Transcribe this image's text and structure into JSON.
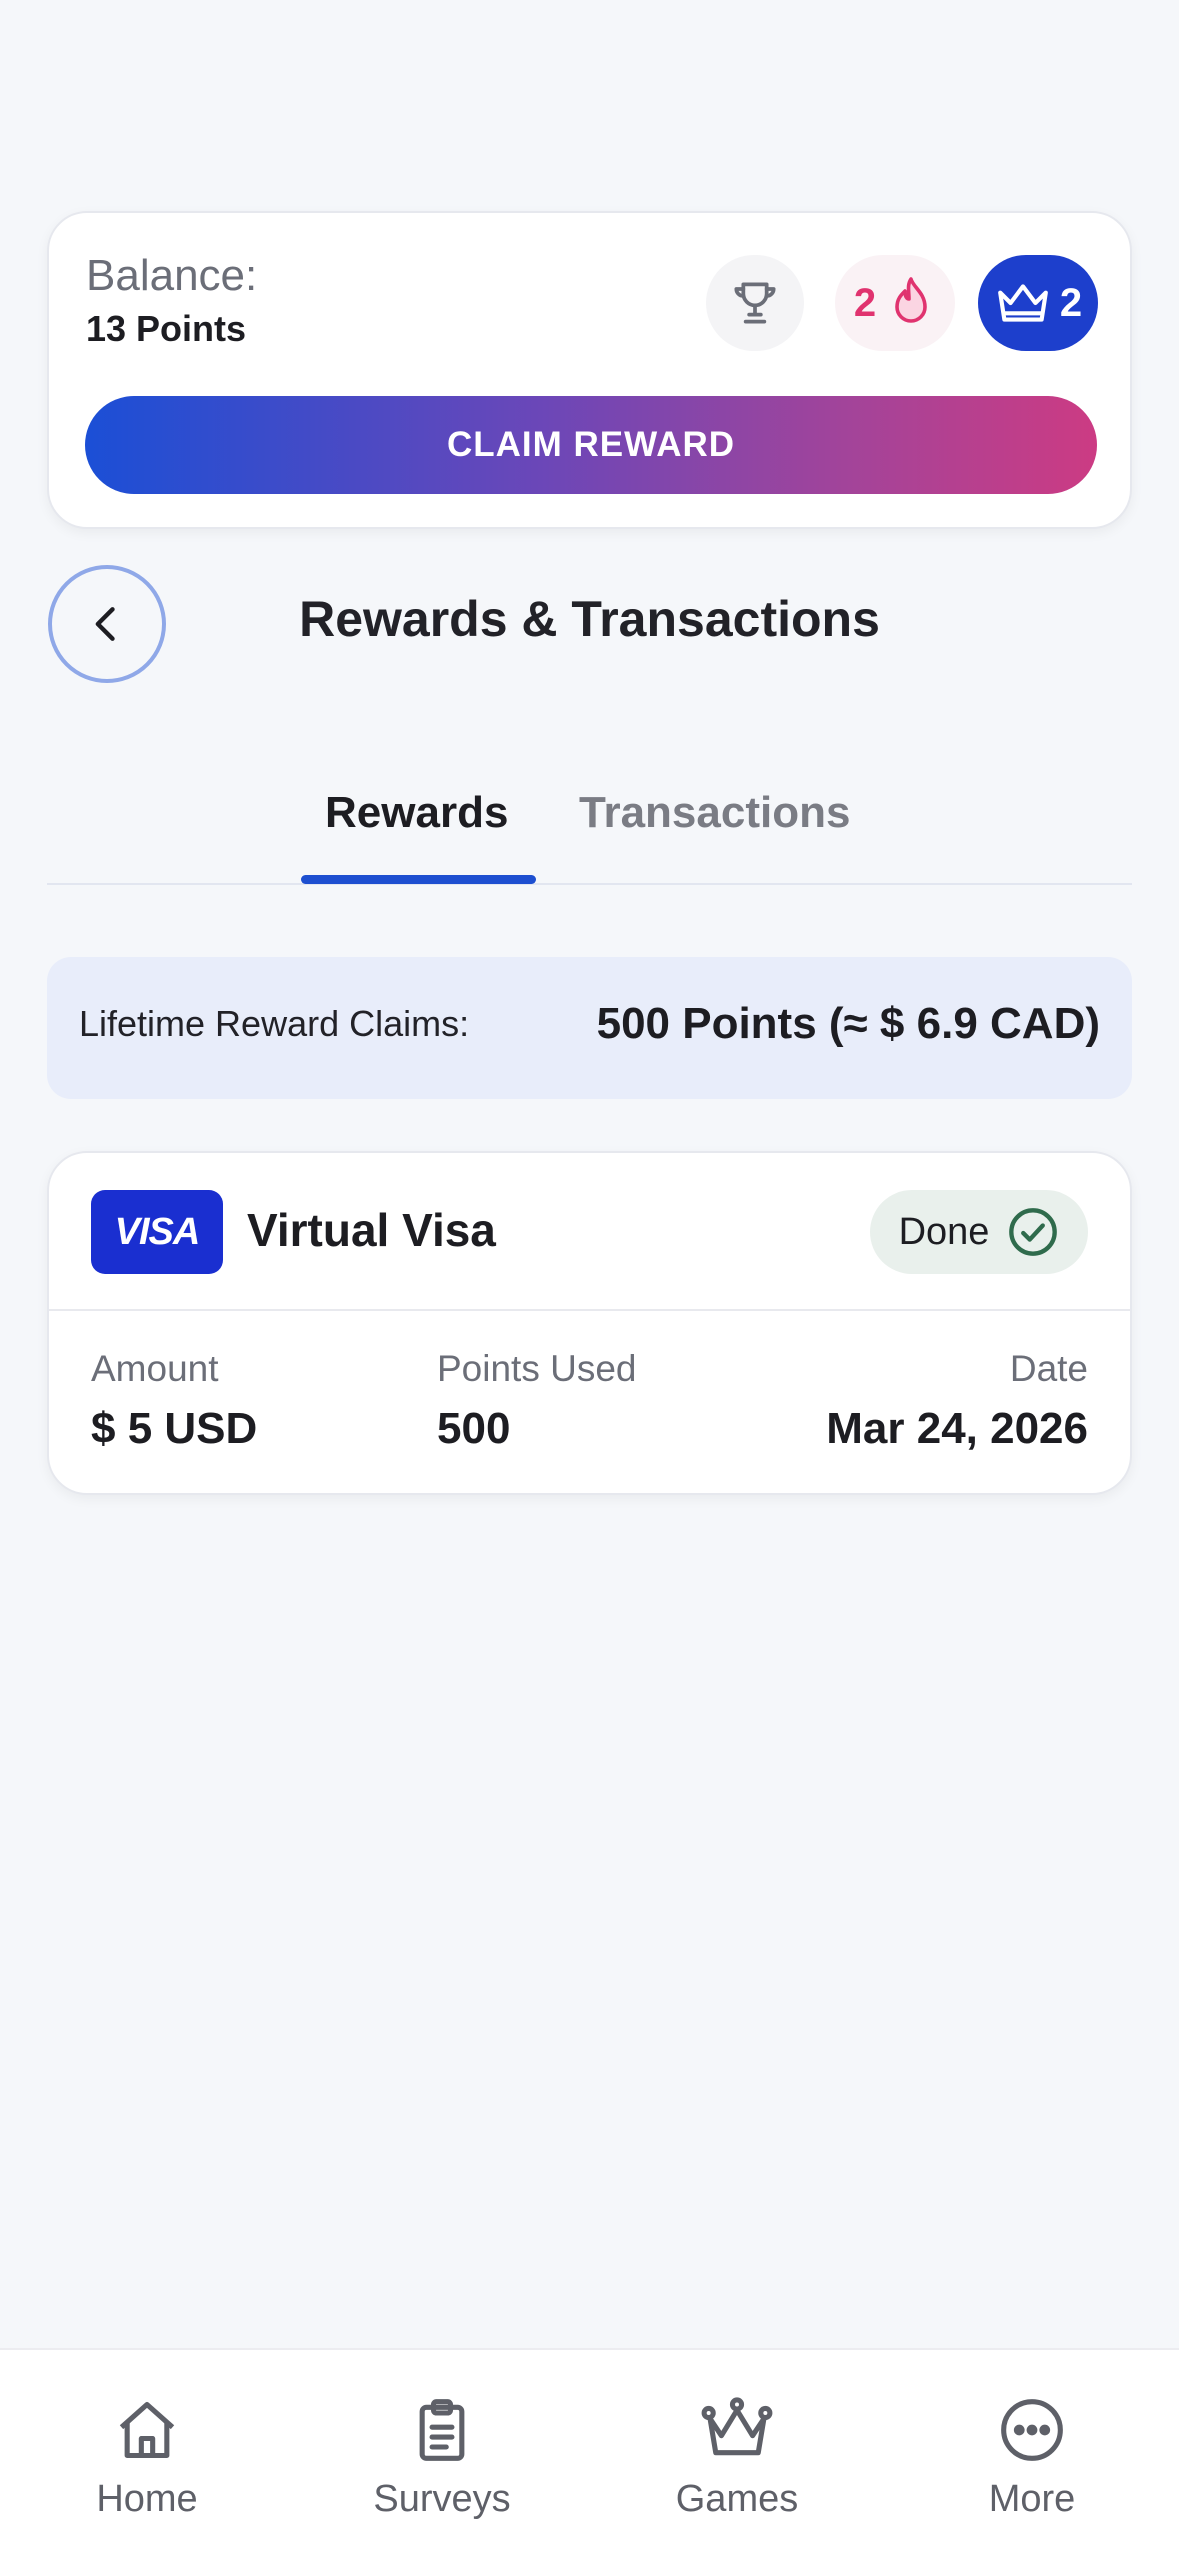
{
  "balance": {
    "label": "Balance:",
    "value": "13 Points",
    "trophy_icon": "trophy-icon",
    "streak_count": "2",
    "streak_icon": "flame-icon",
    "crown_count": "2",
    "crown_icon": "crown-icon"
  },
  "claim_button_label": "CLAIM REWARD",
  "header": {
    "title": "Rewards & Transactions",
    "back_icon": "chevron-left-icon"
  },
  "tabs": [
    {
      "label": "Rewards",
      "active": true
    },
    {
      "label": "Transactions",
      "active": false
    }
  ],
  "lifetime": {
    "label": "Lifetime Reward Claims:",
    "value": "500 Points (≈ $ 6.9 CAD)"
  },
  "reward": {
    "brand_logo_text": "VISA",
    "name": "Virtual Visa",
    "status": "Done",
    "status_icon": "check-circle-icon",
    "amount_label": "Amount",
    "amount_value": "$ 5 USD",
    "points_label": "Points Used",
    "points_value": "500",
    "date_label": "Date",
    "date_value": "Mar 24, 2026"
  },
  "nav": [
    {
      "label": "Home",
      "icon": "home-icon"
    },
    {
      "label": "Surveys",
      "icon": "clipboard-icon"
    },
    {
      "label": "Games",
      "icon": "crown-icon"
    },
    {
      "label": "More",
      "icon": "more-icon"
    }
  ],
  "colors": {
    "accent_blue": "#1d4fd0",
    "gradient_start": "#1b4fd6",
    "gradient_end": "#cc3b83",
    "streak_pink": "#e0336f",
    "success_green": "#2f6b4c"
  }
}
